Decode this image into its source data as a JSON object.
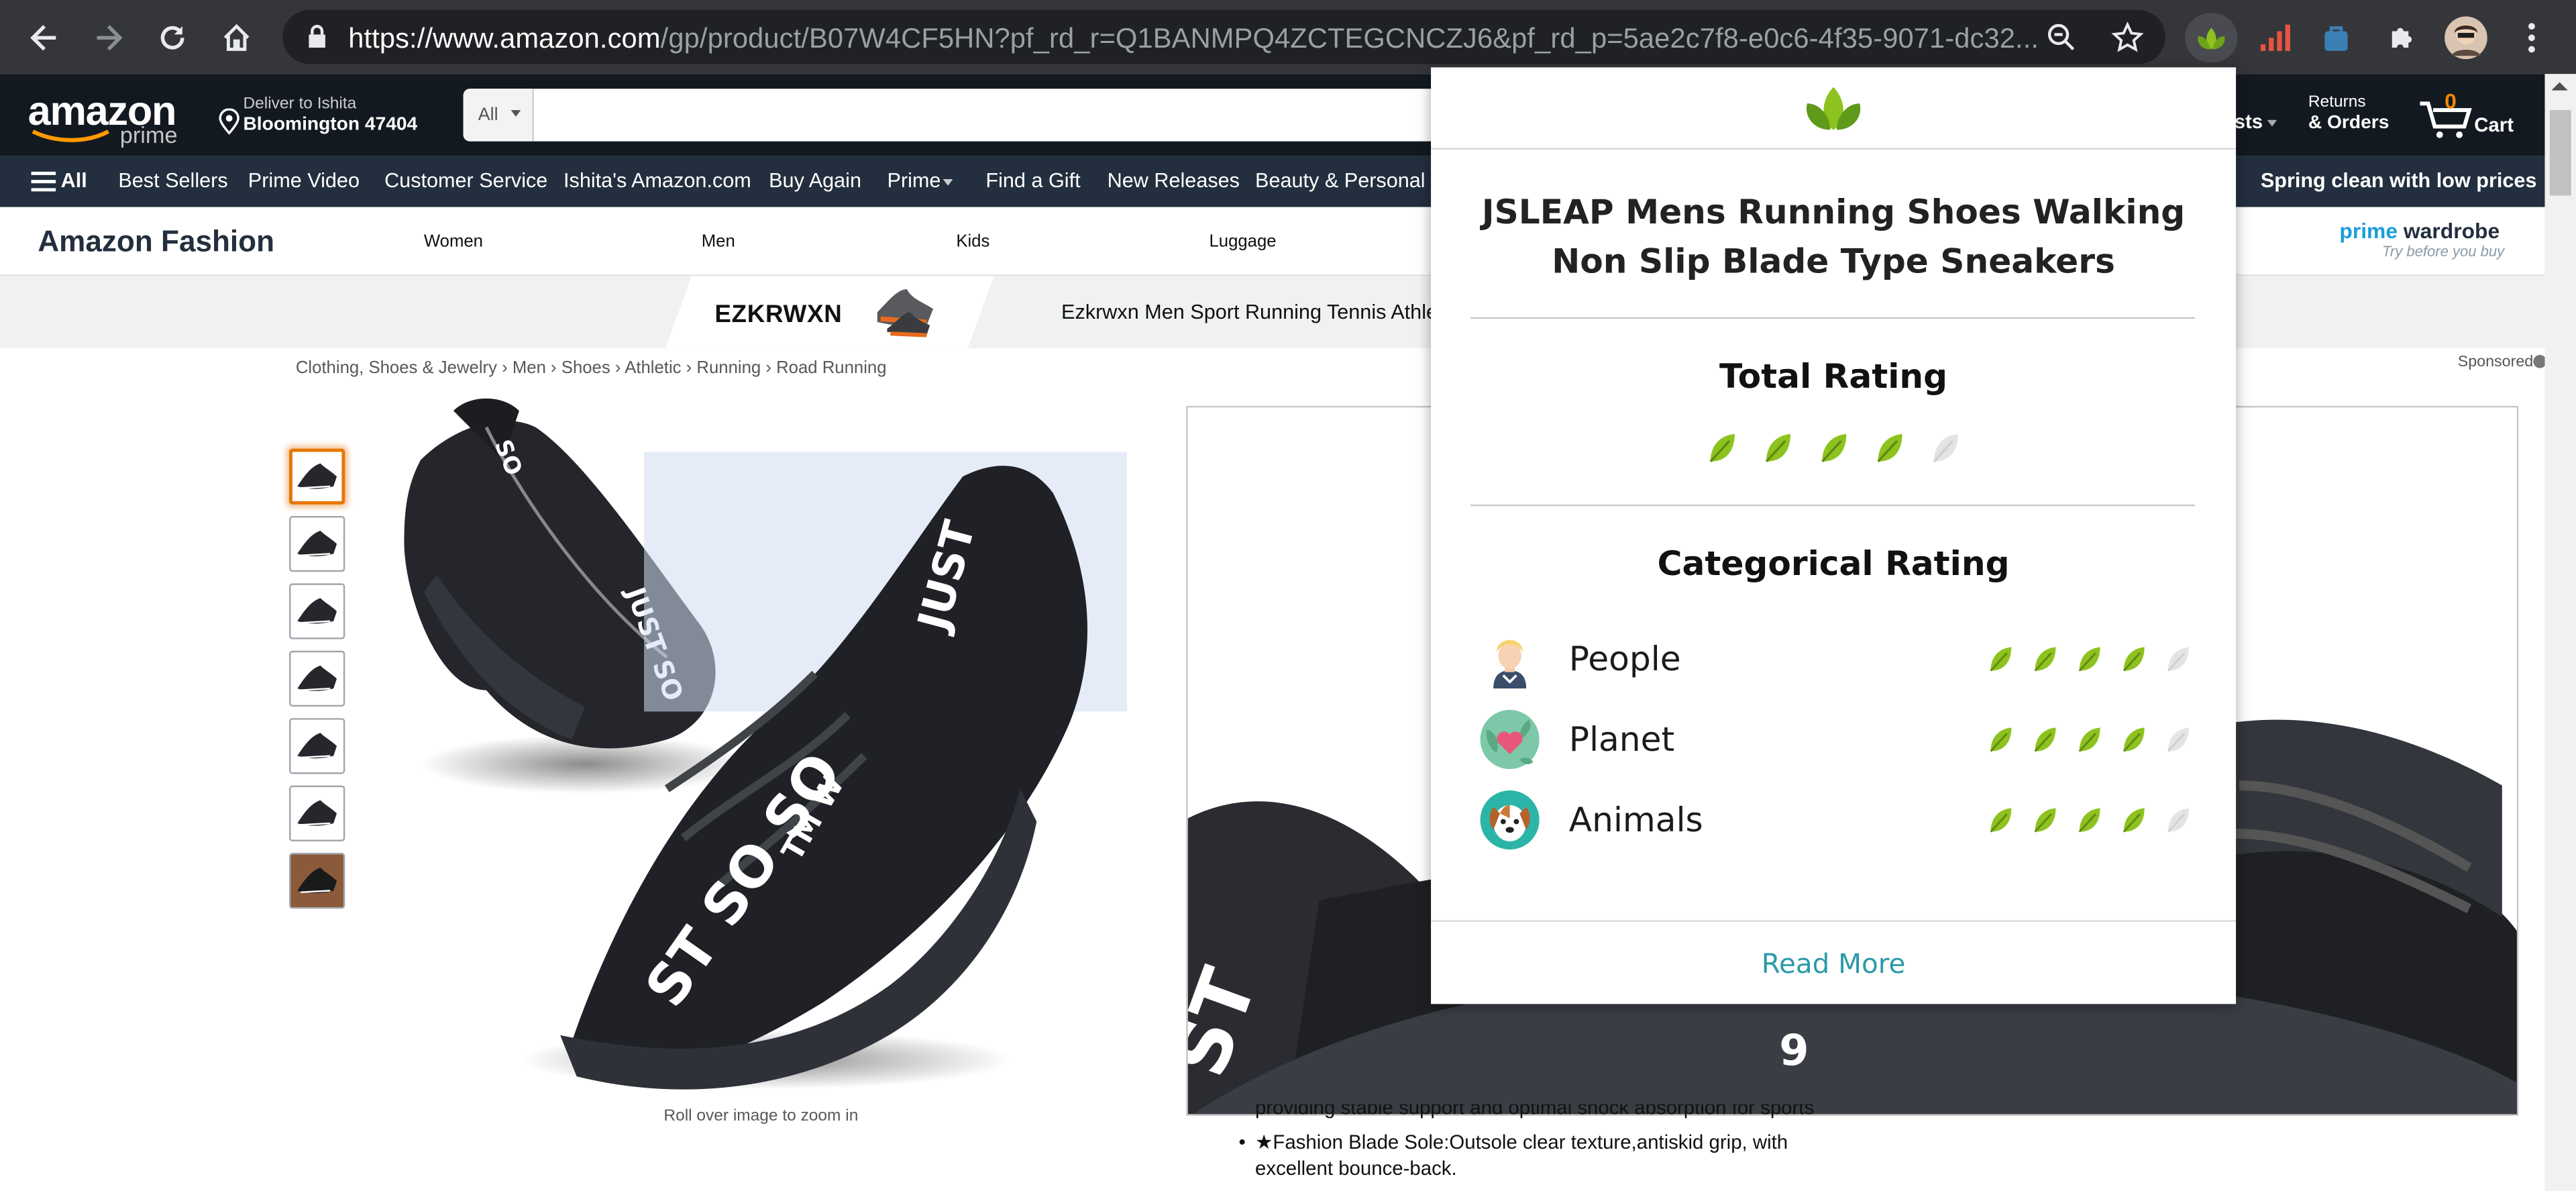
{
  "browser": {
    "url_host": "https://www.amazon.com",
    "url_path": "/gp/product/B07W4CF5HN?pf_rd_r=Q1BANMPQ4ZCTEGCNCZJ6&pf_rd_p=5ae2c7f8-e0c6-4f35-9071-dc32..."
  },
  "header": {
    "logo_text": "amazon",
    "logo_sub": "prime",
    "deliver_line1": "Deliver to Ishita",
    "deliver_line2": "Bloomington 47404",
    "search_category": "All",
    "search_value": "",
    "lists_partial": "sts",
    "returns_line1": "Returns",
    "returns_line2": "& Orders",
    "cart_count": "0",
    "cart_label": "Cart"
  },
  "subnav": {
    "all_label": "All",
    "items": [
      "Best Sellers",
      "Prime Video",
      "Customer Service",
      "Ishita's Amazon.com",
      "Buy Again",
      "Prime",
      "Find a Gift",
      "New Releases",
      "Beauty & Personal Ca"
    ],
    "promo": "Spring clean with low prices"
  },
  "fashion": {
    "title": "Amazon Fashion",
    "categories": [
      "Women",
      "Men",
      "Kids",
      "Luggage"
    ],
    "prime_wardrobe_1": "prime",
    "prime_wardrobe_2": "wardrobe",
    "prime_wardrobe_tag": "Try before you buy"
  },
  "ad": {
    "brand": "EZKRWXN",
    "text": "Ezkrwxn Men Sport Running Tennis Athletic",
    "sponsored": "Sponsored"
  },
  "breadcrumb": [
    "Clothing, Shoes & Jewelry",
    "Men",
    "Shoes",
    "Athletic",
    "Running",
    "Road Running"
  ],
  "product": {
    "zoom_hint": "Roll over image to zoom in",
    "bullet_partial": "providing stable support and optimal shock absorption for sports",
    "bullet_2": "★Fashion Blade Sole:Outsole clear texture,antiskid grip, with excellent bounce-back."
  },
  "popup": {
    "product_title": "JSLEAP Mens Running Shoes Walking Non Slip Blade Type Sneakers",
    "total_heading": "Total Rating",
    "total_rating": 4,
    "max_rating": 5,
    "categorical_heading": "Categorical Rating",
    "categories": [
      {
        "label": "People",
        "rating": 4,
        "icon": "person-avatar-icon"
      },
      {
        "label": "Planet",
        "rating": 4,
        "icon": "planet-heart-icon"
      },
      {
        "label": "Animals",
        "rating": 4,
        "icon": "dog-avatar-icon"
      }
    ],
    "read_more": "Read More",
    "leaf_color": "#8dc21f",
    "leaf_empty_color": "#e4e4e4",
    "link_color": "#2a9aa8"
  }
}
